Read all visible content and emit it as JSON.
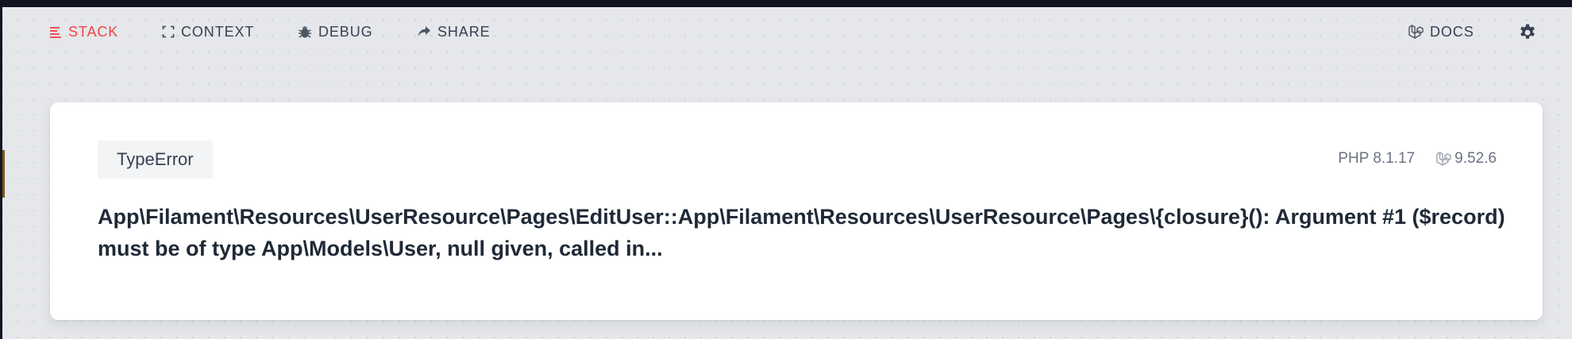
{
  "nav": {
    "items": [
      {
        "label": "STACK",
        "icon": "stack-icon",
        "active": true
      },
      {
        "label": "CONTEXT",
        "icon": "context-icon",
        "active": false
      },
      {
        "label": "DEBUG",
        "icon": "bug-icon",
        "active": false
      },
      {
        "label": "SHARE",
        "icon": "share-icon",
        "active": false
      }
    ],
    "docs_label": "DOCS",
    "settings_icon": "gear-icon"
  },
  "error": {
    "type": "TypeError",
    "php_version": "PHP 8.1.17",
    "laravel_version": "9.52.6",
    "message": "App\\Filament\\Resources\\UserResource\\Pages\\EditUser::App\\Filament\\Resources\\UserResource\\Pages\\{closure}(): Argument #1 ($record) must be of type App\\Models\\User, null given, called in..."
  },
  "colors": {
    "accent": "#ef4444",
    "text": "#374151",
    "background": "#e5e7eb",
    "card": "#ffffff"
  }
}
